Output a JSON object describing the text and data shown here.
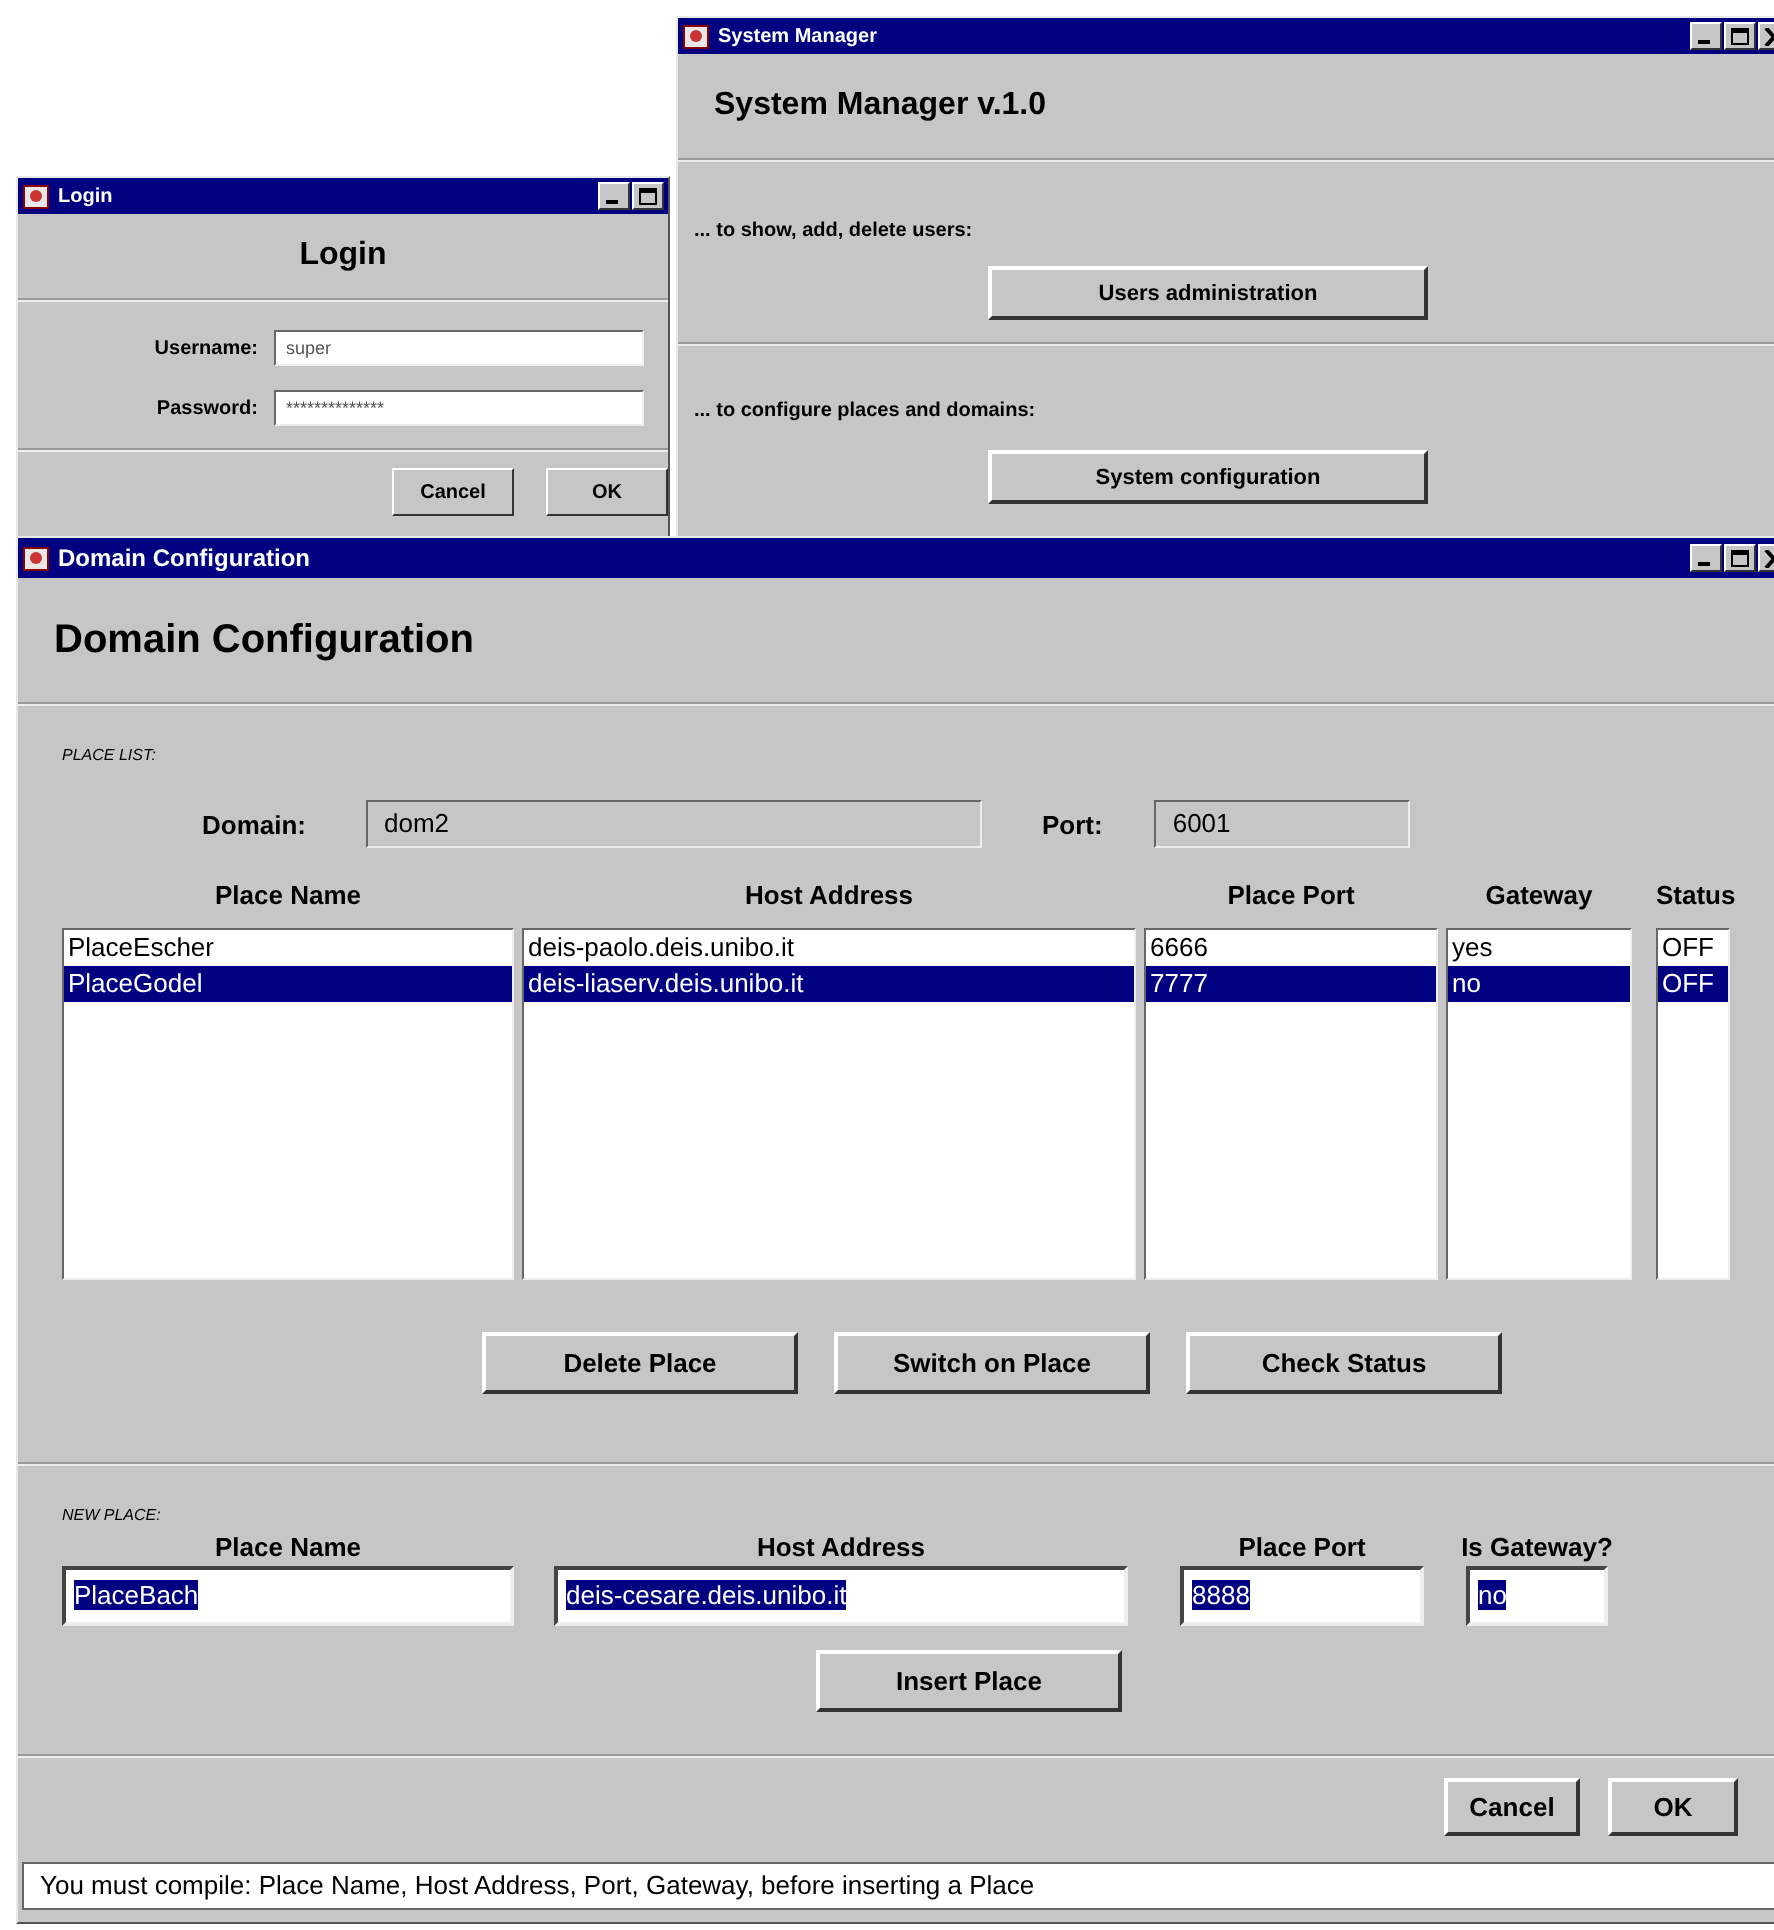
{
  "login_window": {
    "title": "Login",
    "heading": "Login",
    "fields": [
      {
        "label": "Username:",
        "value": "super"
      },
      {
        "label": "Password:",
        "value": "**************"
      }
    ],
    "buttons": [
      "Cancel",
      "OK"
    ]
  },
  "system_manager_window": {
    "title": "System Manager",
    "heading": "System Manager v.1.0",
    "sections": [
      {
        "caption": "... to show, add, delete users:",
        "button": "Users administration"
      },
      {
        "caption": "... to configure places and domains:",
        "button": "System configuration"
      }
    ]
  },
  "domain_window": {
    "title": "Domain Configuration",
    "heading": "Domain Configuration",
    "place_list": {
      "section_label": "PLACE LIST:",
      "domain": {
        "label": "Domain:",
        "value": "dom2"
      },
      "port": {
        "label": "Port:",
        "value": "6001"
      },
      "columns": [
        "Place Name",
        "Host Address",
        "Place Port",
        "Gateway",
        "Status"
      ],
      "rows": [
        {
          "cells": [
            "PlaceEscher",
            "deis-paolo.deis.unibo.it",
            "6666",
            "yes",
            "OFF"
          ],
          "selected": false
        },
        {
          "cells": [
            "PlaceGodel",
            "deis-liaserv.deis.unibo.it",
            "7777",
            "no",
            "OFF"
          ],
          "selected": true
        }
      ],
      "buttons": [
        "Delete Place",
        "Switch on Place",
        "Check Status"
      ]
    },
    "new_place": {
      "section_label": "NEW PLACE:",
      "fields": [
        {
          "label": "Place Name",
          "value": "PlaceBach",
          "text_selected": true
        },
        {
          "label": "Host Address",
          "value": "deis-cesare.deis.unibo.it",
          "text_selected": true
        },
        {
          "label": "Place Port",
          "value": "8888",
          "text_selected": true
        },
        {
          "label": "Is Gateway?",
          "value": "no",
          "text_selected": true
        }
      ],
      "button": "Insert Place"
    },
    "buttons": [
      "Cancel",
      "OK"
    ],
    "status_bar": "You must compile: Place Name, Host Address, Port, Gateway, before inserting a Place"
  }
}
